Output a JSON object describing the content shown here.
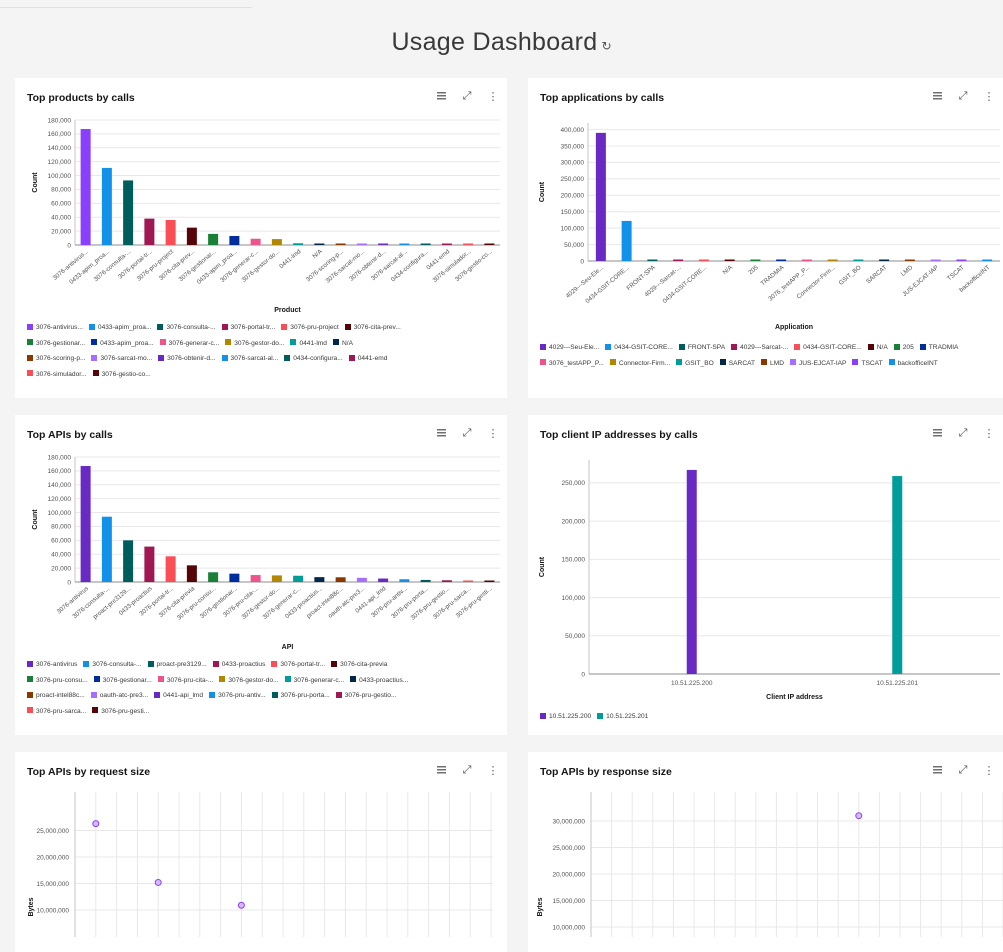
{
  "page": {
    "title": "Usage Dashboard",
    "refresh_icon": "refresh-icon"
  },
  "tile_icons": [
    "table-view-icon",
    "expand-icon",
    "overflow-menu-icon"
  ],
  "tiles": {
    "products": {
      "title": "Top products by calls",
      "chart_data": {
        "type": "bar",
        "xlabel": "Product",
        "ylabel": "Count",
        "ylim": [
          0,
          180000
        ],
        "yticks": [
          0,
          20000,
          40000,
          60000,
          80000,
          100000,
          120000,
          140000,
          160000,
          180000
        ],
        "categories": [
          "3076-antivirus...",
          "0433-apim_proa...",
          "3076-consulta-...",
          "3076-portal-tr...",
          "3076-pru-project",
          "3076-cita-prev...",
          "3076-gestionar...",
          "0433-apim_proa...",
          "3076-generar-c...",
          "3076-gestor-do...",
          "0441-lmd",
          "N/A",
          "3076-scoring-p...",
          "3076-sarcat-mo...",
          "3076-obtenir-d...",
          "3076-sarcat-al...",
          "0434-configura...",
          "0441-emd",
          "3076-simulador...",
          "3076-gestio-co..."
        ],
        "values": [
          167000,
          111000,
          93000,
          38000,
          36000,
          25000,
          16000,
          13000,
          9000,
          8500,
          2500,
          2000,
          1500,
          1200,
          1000,
          900,
          800,
          700,
          600,
          500
        ],
        "colors": [
          "#8a3ffc",
          "#1192e8",
          "#005d5d",
          "#9f1853",
          "#fa4d56",
          "#570408",
          "#198038",
          "#002d9c",
          "#ee538b",
          "#b28600",
          "#009d9a",
          "#012749",
          "#8a3800",
          "#a56eff",
          "#6929c4",
          "#1192e8",
          "#005d5d",
          "#9f1853",
          "#fa4d56",
          "#570408"
        ]
      },
      "legend": [
        "3076-antivirus...",
        "0433-apim_proa...",
        "3076-consulta-...",
        "3076-portal-tr...",
        "3076-pru-project",
        "3076-cita-prev...",
        "3076-gestionar...",
        "0433-apim_proa...",
        "3076-generar-c...",
        "3076-gestor-do...",
        "0441-lmd",
        "N/A",
        "3076-scoring-p...",
        "3076-sarcat-mo...",
        "3076-obtenir-d...",
        "3076-sarcat-al...",
        "0434-configura...",
        "0441-emd",
        "3076-simulador...",
        "3076-gestio-co..."
      ]
    },
    "applications": {
      "title": "Top applications by calls",
      "chart_data": {
        "type": "bar",
        "xlabel": "Application",
        "ylabel": "Count",
        "ylim": [
          0,
          420000
        ],
        "yticks": [
          0,
          50000,
          100000,
          150000,
          200000,
          250000,
          300000,
          350000,
          400000
        ],
        "categories": [
          "4029---Seu-Ele...",
          "0434-GSIT-CORE...",
          "FRONT-SPA",
          "4029---Sarcat-...",
          "0434-GSIT-CORE...",
          "N/A",
          "205",
          "TRADMIA",
          "3076_testAPP_P...",
          "Connector-Firm...",
          "GSIT_BO",
          "SARCAT",
          "LMD",
          "JUS-EJCAT-IAP",
          "TSCAT",
          "backofficeINT"
        ],
        "values": [
          390000,
          122000,
          3000,
          2500,
          2200,
          2000,
          1800,
          1600,
          1400,
          1200,
          1000,
          900,
          800,
          700,
          600,
          500
        ],
        "colors": [
          "#6929c4",
          "#1192e8",
          "#005d5d",
          "#9f1853",
          "#fa4d56",
          "#570408",
          "#198038",
          "#002d9c",
          "#ee538b",
          "#b28600",
          "#009d9a",
          "#012749",
          "#8a3800",
          "#a56eff",
          "#8a3ffc",
          "#1192e8"
        ]
      },
      "legend": [
        "4029---Seu-Ele...",
        "0434-GSIT-CORE...",
        "FRONT-SPA",
        "4029---Sarcat-...",
        "0434-GSIT-CORE...",
        "N/A",
        "205",
        "TRADMIA",
        "3076_testAPP_P...",
        "Connector-Firm...",
        "GSIT_BO",
        "SARCAT",
        "LMD",
        "JUS-EJCAT-IAP",
        "TSCAT",
        "backofficeINT"
      ]
    },
    "apis": {
      "title": "Top APIs by calls",
      "chart_data": {
        "type": "bar",
        "xlabel": "API",
        "ylabel": "Count",
        "ylim": [
          0,
          180000
        ],
        "yticks": [
          0,
          20000,
          40000,
          60000,
          80000,
          100000,
          120000,
          140000,
          160000,
          180000
        ],
        "categories": [
          "3076-antivirus",
          "3076-consulta-...",
          "proact-pre3129...",
          "0433-proactius",
          "3076-portal-tr...",
          "3076-cita-previa",
          "3076-pru-consu...",
          "3076-gestionar...",
          "3076-pru-cita-...",
          "3076-gestor-do...",
          "3076-generar-c...",
          "0433-proactius...",
          "proact-intel88c...",
          "oauth-atc-pre3...",
          "0441-api_lmd",
          "3076-pru-antiv...",
          "3076-pru-porta...",
          "3076-pru-gestio...",
          "3076-pru-sarca...",
          "3076-pru-gesti..."
        ],
        "values": [
          167000,
          94000,
          60000,
          51000,
          37000,
          24000,
          14000,
          12000,
          10000,
          9500,
          9000,
          7000,
          6800,
          6000,
          5000,
          4000,
          3000,
          2500,
          2000,
          1500
        ],
        "colors": [
          "#6929c4",
          "#1192e8",
          "#005d5d",
          "#9f1853",
          "#fa4d56",
          "#570408",
          "#198038",
          "#002d9c",
          "#ee538b",
          "#b28600",
          "#009d9a",
          "#012749",
          "#8a3800",
          "#a56eff",
          "#6929c4",
          "#1192e8",
          "#005d5d",
          "#9f1853",
          "#fa4d56",
          "#570408"
        ]
      },
      "legend": [
        "3076-antivirus",
        "3076-consulta-...",
        "proact-pre3129...",
        "0433-proactius",
        "3076-portal-tr...",
        "3076-cita-previa",
        "3076-pru-consu...",
        "3076-gestionar...",
        "3076-pru-cita-...",
        "3076-gestor-do...",
        "3076-generar-c...",
        "0433-proactius...",
        "proact-intel88c...",
        "oauth-atc-pre3...",
        "0441-api_lmd",
        "3076-pru-antiv...",
        "3076-pru-porta...",
        "3076-pru-gestio...",
        "3076-pru-sarca...",
        "3076-pru-gesti..."
      ]
    },
    "client_ips": {
      "title": "Top client IP addresses by calls",
      "chart_data": {
        "type": "bar",
        "xlabel": "Client IP address",
        "ylabel": "Count",
        "ylim": [
          0,
          280000
        ],
        "yticks": [
          0,
          50000,
          100000,
          150000,
          200000,
          250000
        ],
        "categories": [
          "10.51.225.200",
          "10.51.225.201"
        ],
        "values": [
          267000,
          259000
        ],
        "colors": [
          "#6929c4",
          "#009d9a"
        ]
      },
      "legend": [
        "10.51.225.200",
        "10.51.225.201"
      ]
    },
    "req_size": {
      "title": "Top APIs by request size",
      "chart_data": {
        "type": "scatter",
        "ylabel": "Bytes",
        "yticks": [
          10000000,
          15000000,
          20000000,
          25000000
        ],
        "points": [
          {
            "x": 1,
            "y": 26300000
          },
          {
            "x": 4,
            "y": 15200000
          },
          {
            "x": 8,
            "y": 10900000
          }
        ],
        "color": "#8a3ffc"
      }
    },
    "resp_size": {
      "title": "Top APIs by response size",
      "chart_data": {
        "type": "scatter",
        "ylabel": "Bytes",
        "yticks": [
          10000000,
          15000000,
          20000000,
          25000000,
          30000000
        ],
        "points": [
          {
            "x": 13,
            "y": 31000000
          }
        ],
        "color": "#8a3ffc"
      }
    }
  }
}
